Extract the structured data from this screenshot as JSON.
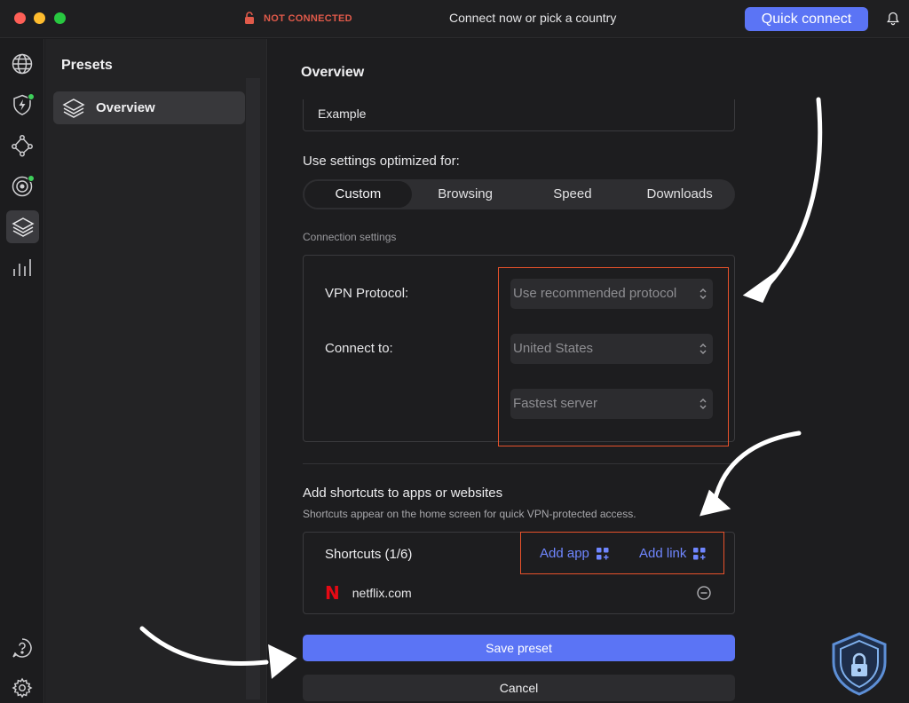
{
  "titlebar": {
    "status": "NOT CONNECTED",
    "center_text": "Connect now or pick a country",
    "quick_connect": "Quick connect"
  },
  "rail": {
    "icons": [
      "globe-icon",
      "shield-bolt-icon",
      "mesh-icon",
      "target-icon",
      "layers-icon",
      "stats-icon",
      "help-icon",
      "settings-icon"
    ]
  },
  "presets": {
    "title": "Presets",
    "items": [
      {
        "label": "Overview"
      }
    ]
  },
  "main": {
    "title": "Overview",
    "name_value": "Example",
    "optimized_label": "Use settings optimized for:",
    "segments": [
      "Custom",
      "Browsing",
      "Speed",
      "Downloads"
    ],
    "selected_segment": "Custom",
    "connection_label": "Connection settings",
    "protocol_label": "VPN Protocol:",
    "protocol_value": "Use recommended protocol",
    "connect_to_label": "Connect to:",
    "country_value": "United States",
    "server_value": "Fastest server",
    "shortcuts_title": "Add shortcuts to apps or websites",
    "shortcuts_sub": "Shortcuts appear on the home screen for quick VPN-protected access.",
    "shortcuts_box_title": "Shortcuts (1/6)",
    "add_app": "Add app",
    "add_link": "Add link",
    "shortcut_items": [
      {
        "label": "netflix.com"
      }
    ],
    "save": "Save preset",
    "cancel": "Cancel"
  },
  "colors": {
    "accent": "#5b74f5",
    "link": "#6f86ff",
    "highlight": "#e8522b",
    "status_red": "#e05a4a",
    "online_green": "#3ecf5b"
  }
}
